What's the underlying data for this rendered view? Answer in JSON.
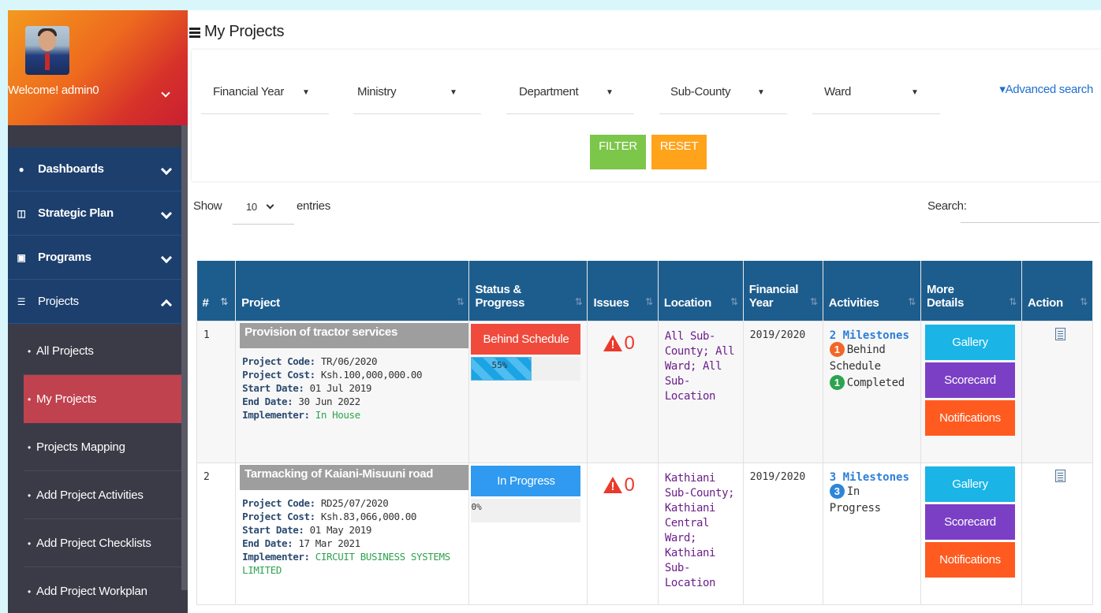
{
  "sidebar": {
    "welcome": "Welcome! admin0",
    "nav": [
      {
        "label": "Dashboards",
        "icon": "dashboard-icon"
      },
      {
        "label": "Strategic Plan",
        "icon": "columns-icon"
      },
      {
        "label": "Programs",
        "icon": "programs-icon"
      },
      {
        "label": "Projects",
        "icon": "list-icon"
      }
    ],
    "subitems": [
      {
        "label": "All Projects"
      },
      {
        "label": "My Projects"
      },
      {
        "label": "Projects Mapping"
      },
      {
        "label": "Add Project Activities"
      },
      {
        "label": "Add Project Checklists"
      },
      {
        "label": "Add Project Workplan"
      }
    ]
  },
  "page": {
    "title": "My Projects"
  },
  "filters": {
    "financial_year": "Financial Year",
    "ministry": "Ministry",
    "department": "Department",
    "sub_county": "Sub-County",
    "ward": "Ward",
    "advanced": "▾Advanced search",
    "filter_button": "FILTER",
    "reset_button": "RESET"
  },
  "table_controls": {
    "show": "Show",
    "entries_value": "10",
    "entries": "entries",
    "search": "Search:"
  },
  "table": {
    "headers": {
      "num": "#",
      "project": "Project",
      "status_line1": "Status &",
      "status_line2": "Progress",
      "issues": "Issues",
      "location": "Location",
      "fy_line1": "Financial",
      "fy_line2": "Year",
      "activities": "Activities",
      "details_line1": "More",
      "details_line2": "Details",
      "action": "Action"
    },
    "labels": {
      "code": "Project Code:",
      "cost": "Project Cost:",
      "start": "Start Date:",
      "end": "End Date:",
      "implementer": "Implementer:"
    },
    "rows": [
      {
        "num": "1",
        "title": "Provision of tractor services",
        "code": "TR/06/2020",
        "cost": "Ksh.100,000,000.00",
        "start": "01 Jul 2019",
        "end": "30 Jun 2022",
        "implementer": "In House",
        "status": "Behind Schedule",
        "progress_text": "55%",
        "progress": 55,
        "issues": "0",
        "location_lines": [
          "All Sub-",
          "County; All",
          "Ward; All",
          "Sub-Location"
        ],
        "financial_year": "2019/2020",
        "milestones": "2 Milestones",
        "activity_lines": [
          {
            "badge": "1",
            "text": "Behind"
          },
          {
            "badge": "",
            "text": "Schedule"
          },
          {
            "badge": "1",
            "text": "Completed"
          }
        ],
        "gallery": "Gallery",
        "scorecard": "Scorecard",
        "notifications": "Notifications"
      },
      {
        "num": "2",
        "title": "Tarmacking of Kaiani-Misuuni road",
        "code": "RD25/07/2020",
        "cost": "Ksh.83,066,000.00",
        "start": "01 May 2019",
        "end": "17 Mar 2021",
        "implementer_line1": "CIRCUIT BUSINESS SYSTEMS",
        "implementer_line2": "LIMITED",
        "status": "In Progress",
        "progress_text": "0%",
        "progress": 0,
        "issues": "0",
        "location_lines": [
          "Kathiani",
          "Sub-County;",
          "Kathiani",
          "Central",
          "Ward;",
          "Kathiani",
          "Sub-Location"
        ],
        "financial_year": "2019/2020",
        "milestones": "3 Milestones",
        "activity_lines": [
          {
            "badge": "3",
            "text": "In Progress"
          }
        ],
        "gallery": "Gallery",
        "scorecard": "Scorecard",
        "notifications": "Notifications"
      }
    ]
  },
  "colors": {
    "header_blue": "#1d5d8e",
    "nav_blue": "#1c3f6e",
    "active_red": "#c0424f",
    "filter_green": "#7cc64a",
    "reset_orange": "#ffa31a",
    "behind_red": "#f04a3c",
    "progress_blue": "#2f9af0",
    "gallery_cyan": "#1ab4e6",
    "scorecard_purple": "#7b3fc6",
    "notif_orange": "#ff5a1f"
  }
}
